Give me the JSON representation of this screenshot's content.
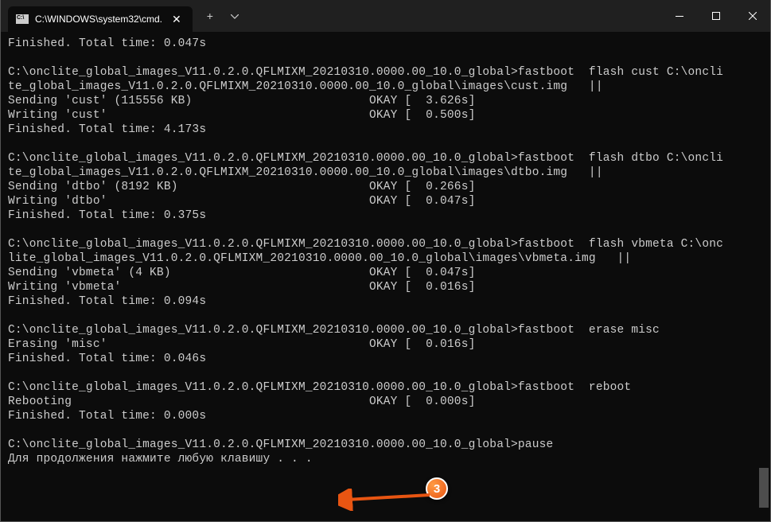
{
  "titlebar": {
    "tab_title": "C:\\WINDOWS\\system32\\cmd."
  },
  "annotation": {
    "badge_number": "3"
  },
  "terminal": {
    "lines": [
      "Finished. Total time: 0.047s",
      "",
      "C:\\onclite_global_images_V11.0.2.0.QFLMIXM_20210310.0000.00_10.0_global>fastboot  flash cust C:\\oncli",
      "te_global_images_V11.0.2.0.QFLMIXM_20210310.0000.00_10.0_global\\images\\cust.img   ||",
      "Sending 'cust' (115556 KB)                         OKAY [  3.626s]",
      "Writing 'cust'                                     OKAY [  0.500s]",
      "Finished. Total time: 4.173s",
      "",
      "C:\\onclite_global_images_V11.0.2.0.QFLMIXM_20210310.0000.00_10.0_global>fastboot  flash dtbo C:\\oncli",
      "te_global_images_V11.0.2.0.QFLMIXM_20210310.0000.00_10.0_global\\images\\dtbo.img   ||",
      "Sending 'dtbo' (8192 KB)                           OKAY [  0.266s]",
      "Writing 'dtbo'                                     OKAY [  0.047s]",
      "Finished. Total time: 0.375s",
      "",
      "C:\\onclite_global_images_V11.0.2.0.QFLMIXM_20210310.0000.00_10.0_global>fastboot  flash vbmeta C:\\onc",
      "lite_global_images_V11.0.2.0.QFLMIXM_20210310.0000.00_10.0_global\\images\\vbmeta.img   ||",
      "Sending 'vbmeta' (4 KB)                            OKAY [  0.047s]",
      "Writing 'vbmeta'                                   OKAY [  0.016s]",
      "Finished. Total time: 0.094s",
      "",
      "C:\\onclite_global_images_V11.0.2.0.QFLMIXM_20210310.0000.00_10.0_global>fastboot  erase misc",
      "Erasing 'misc'                                     OKAY [  0.016s]",
      "Finished. Total time: 0.046s",
      "",
      "C:\\onclite_global_images_V11.0.2.0.QFLMIXM_20210310.0000.00_10.0_global>fastboot  reboot",
      "Rebooting                                          OKAY [  0.000s]",
      "Finished. Total time: 0.000s",
      "",
      "C:\\onclite_global_images_V11.0.2.0.QFLMIXM_20210310.0000.00_10.0_global>pause",
      "Для продолжения нажмите любую клавишу . . ."
    ]
  }
}
